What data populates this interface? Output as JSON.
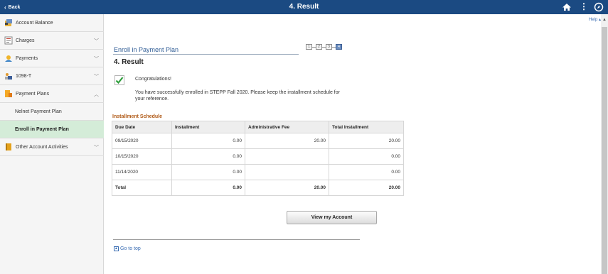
{
  "header": {
    "back_label": "Back",
    "title": "4. Result"
  },
  "sidebar": {
    "items": [
      {
        "label": "Account Balance",
        "icon": "wallet-icon",
        "expandable": false
      },
      {
        "label": "Charges",
        "icon": "invoice-icon",
        "expandable": true
      },
      {
        "label": "Payments",
        "icon": "payments-icon",
        "expandable": true
      },
      {
        "label": "1098-T",
        "icon": "tax-form-icon",
        "expandable": true
      },
      {
        "label": "Payment Plans",
        "icon": "payment-plan-icon",
        "expandable": true,
        "expanded": true
      },
      {
        "label": "Nelnet Payment Plan",
        "sub": true
      },
      {
        "label": "Enroll in Payment Plan",
        "sub": true,
        "active": true
      },
      {
        "label": "Other Account Activities",
        "icon": "book-icon",
        "expandable": true
      }
    ]
  },
  "main": {
    "help_label": "Help",
    "enroll_title": "Enroll in Payment Plan",
    "steps": [
      "1",
      "2",
      "3",
      "4"
    ],
    "current_step": 4,
    "result_heading": "4. Result",
    "congrats": "Congratulations!",
    "message": "You have successfully enrolled in STEPP Fall 2020.  Please keep the installment schedule for your reference.",
    "schedule_caption": "Installment Schedule",
    "schedule": {
      "headers": [
        "Due Date",
        "Installment",
        "Administrative Fee",
        "Total Installment"
      ],
      "rows": [
        [
          "09/15/2020",
          "0.00",
          "20.00",
          "20.00"
        ],
        [
          "10/15/2020",
          "0.00",
          "",
          "0.00"
        ],
        [
          "11/14/2020",
          "0.00",
          "",
          "0.00"
        ]
      ],
      "total": [
        "Total",
        "0.00",
        "20.00",
        "20.00"
      ]
    },
    "view_account_label": "View my Account",
    "goto_top_label": "Go to top"
  },
  "colors": {
    "header_bg": "#1b4a82",
    "active_nav_bg": "#d4ecd8",
    "caption": "#b05a17",
    "link": "#3a6db3",
    "check": "#2e9e3c"
  }
}
